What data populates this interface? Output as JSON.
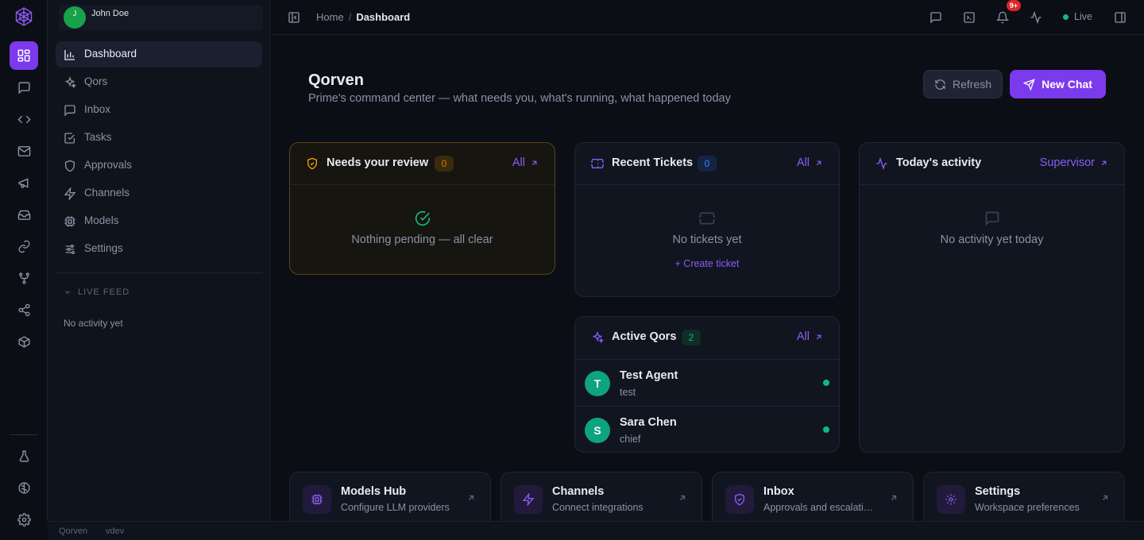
{
  "user": {
    "name": "John Doe",
    "initial": "J"
  },
  "sidebar": {
    "items": [
      {
        "label": "Dashboard"
      },
      {
        "label": "Qors"
      },
      {
        "label": "Inbox"
      },
      {
        "label": "Tasks"
      },
      {
        "label": "Approvals"
      },
      {
        "label": "Channels"
      },
      {
        "label": "Models"
      },
      {
        "label": "Settings"
      }
    ],
    "live_feed": {
      "title": "LIVE FEED",
      "empty": "No activity yet"
    }
  },
  "topbar": {
    "breadcrumb": {
      "home": "Home",
      "separator": "/",
      "current": "Dashboard"
    },
    "notification_count": "9+",
    "status": "Live"
  },
  "page": {
    "title": "Qorven",
    "subtitle": "Prime's command center — what needs you, what's running, what happened today",
    "refresh_label": "Refresh",
    "new_chat_label": "New Chat"
  },
  "cards": {
    "review": {
      "title": "Needs your review",
      "count": "0",
      "link": "All",
      "empty": "Nothing pending — all clear"
    },
    "tickets": {
      "title": "Recent Tickets",
      "count": "0",
      "link": "All",
      "empty": "No tickets yet",
      "action": "+ Create ticket"
    },
    "activity": {
      "title": "Today's activity",
      "link": "Supervisor",
      "empty": "No activity yet today"
    },
    "qors": {
      "title": "Active Qors",
      "count": "2",
      "link": "All",
      "items": [
        {
          "initial": "T",
          "name": "Test Agent",
          "role": "test"
        },
        {
          "initial": "S",
          "name": "Sara Chen",
          "role": "chief"
        }
      ]
    }
  },
  "quick_links": [
    {
      "title": "Models Hub",
      "subtitle": "Configure LLM providers"
    },
    {
      "title": "Channels",
      "subtitle": "Connect integrations"
    },
    {
      "title": "Inbox",
      "subtitle": "Approvals and escalations"
    },
    {
      "title": "Settings",
      "subtitle": "Workspace preferences"
    }
  ],
  "statusbar": {
    "app": "Qorven",
    "version": "vdev"
  },
  "colors": {
    "accent": "#7c3aed",
    "link": "#8b5cf6",
    "success": "#10b981",
    "warning": "#d97706",
    "info": "#3b82f6",
    "alert": "#dc2626"
  }
}
